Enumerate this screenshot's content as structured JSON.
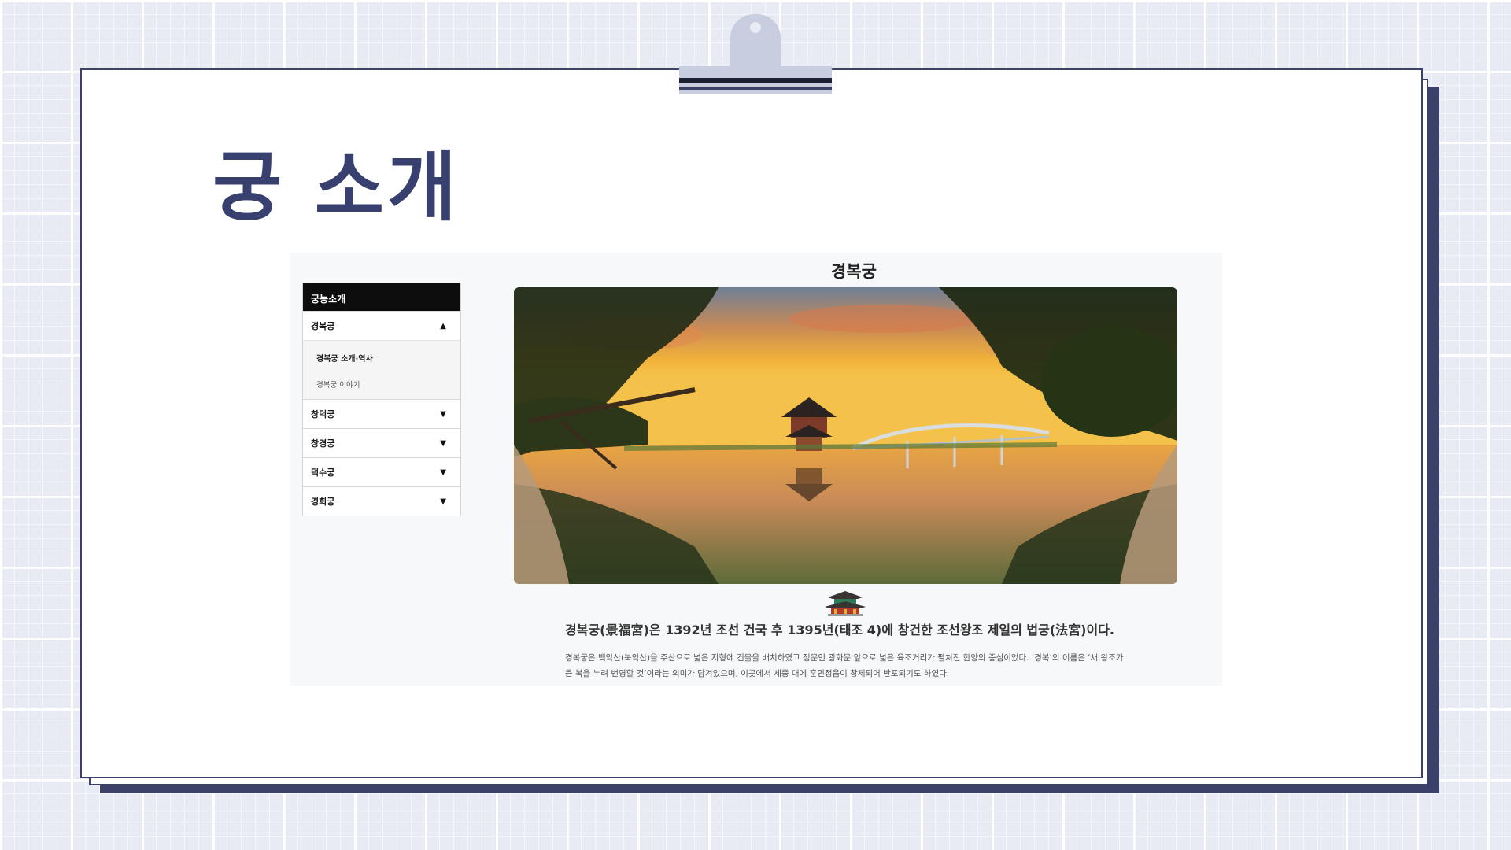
{
  "slide": {
    "title": "궁 소개"
  },
  "sidebar": {
    "header": "궁능소개",
    "items": [
      {
        "label": "경복궁",
        "expanded": true,
        "chevron": "▲",
        "submenu": [
          {
            "label": "경복궁 소개·역사",
            "active": true
          },
          {
            "label": "경복궁 이야기",
            "active": false
          }
        ]
      },
      {
        "label": "창덕궁",
        "expanded": false,
        "chevron": "▼"
      },
      {
        "label": "창경궁",
        "expanded": false,
        "chevron": "▼"
      },
      {
        "label": "덕수궁",
        "expanded": false,
        "chevron": "▼"
      },
      {
        "label": "경희궁",
        "expanded": false,
        "chevron": "▼"
      }
    ]
  },
  "content": {
    "title": "경복궁",
    "image_icon": "palace-pavilion-photo",
    "decor_icon": "palace-icon",
    "headline": "경복궁(景福宮)은 1392년 조선 건국 후 1395년(태조 4)에 창건한 조선왕조 제일의 법궁(法宮)이다.",
    "description": "경복궁은 백악산(북악산)을 주산으로 넓은 지형에 건물을 배치하였고 정문인 광화문 앞으로 넓은 육조거리가 펼쳐진 한양의 중심이었다. ‘경복’의 이름은 ‘새 왕조가 큰 복을 누려 번영할 것’이라는 의미가 담겨있으며, 이곳에서 세종 대에 훈민정음이 창제되어 반포되기도 하였다."
  },
  "colors": {
    "accent": "#384070",
    "grid_bg": "#e9ebf4",
    "menu_header_bg": "#0d0d0d"
  }
}
